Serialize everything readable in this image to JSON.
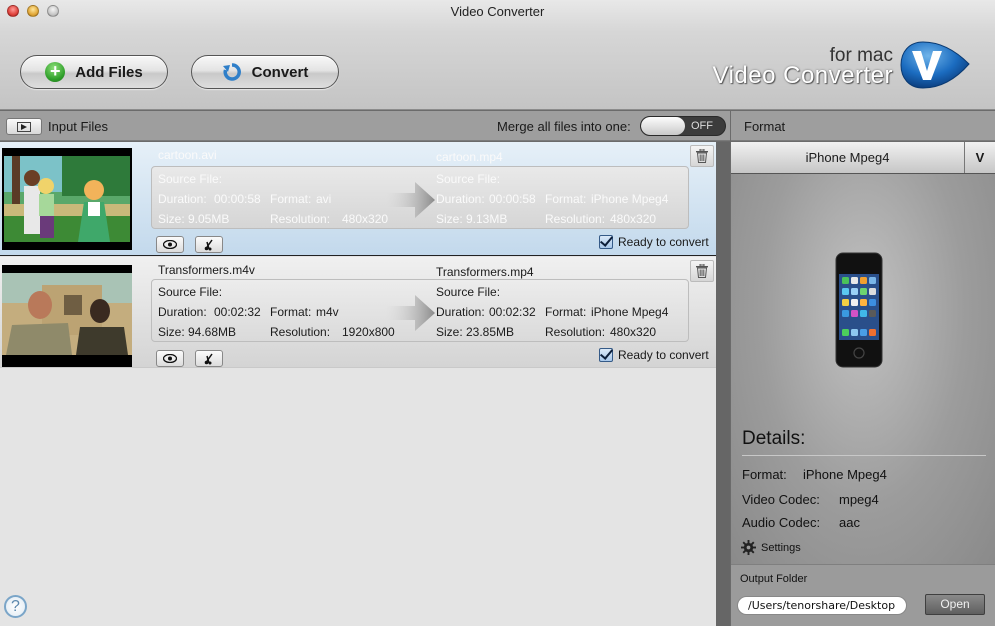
{
  "window": {
    "title": "Video Converter"
  },
  "toolbar": {
    "add_files_label": "Add Files",
    "convert_label": "Convert",
    "brand_sub": "for mac",
    "brand_name": "Video Converter",
    "brand_logo_letter": "V"
  },
  "input_panel": {
    "label": "Input Files",
    "merge_label": "Merge all files into one:",
    "merge_toggle": "OFF"
  },
  "labels": {
    "source_file": "Source File:",
    "duration": "Duration:",
    "format": "Format:",
    "size": "Size:",
    "resolution": "Resolution:",
    "ready": "Ready to convert"
  },
  "files": [
    {
      "source": {
        "name": "cartoon.avi",
        "duration": "00:00:58",
        "format": "avi",
        "size": "9.05MB",
        "resolution": "480x320"
      },
      "target": {
        "name": "cartoon.mp4",
        "duration": "00:00:58",
        "format": "iPhone Mpeg4",
        "size": "9.13MB",
        "resolution": "480x320"
      },
      "ready": true,
      "selected": true
    },
    {
      "source": {
        "name": "Transformers.m4v",
        "duration": "00:02:32",
        "format": "m4v",
        "size": "94.68MB",
        "resolution": "1920x800"
      },
      "target": {
        "name": "Transformers.mp4",
        "duration": "00:02:32",
        "format": "iPhone Mpeg4",
        "size": "23.85MB",
        "resolution": "480x320"
      },
      "ready": true,
      "selected": false
    }
  ],
  "format_panel": {
    "label": "Format",
    "selected": "iPhone Mpeg4",
    "dropdown_glyph": "V",
    "details_title": "Details:",
    "details": [
      {
        "label": "Format:",
        "value": "iPhone Mpeg4"
      },
      {
        "label": "Video Codec:",
        "value": "mpeg4"
      },
      {
        "label": "Audio Codec:",
        "value": "aac"
      }
    ],
    "settings_label": "Settings"
  },
  "output": {
    "label": "Output Folder",
    "path": "/Users/tenorshare/Desktop",
    "open_label": "Open"
  },
  "help": {
    "glyph": "?"
  }
}
